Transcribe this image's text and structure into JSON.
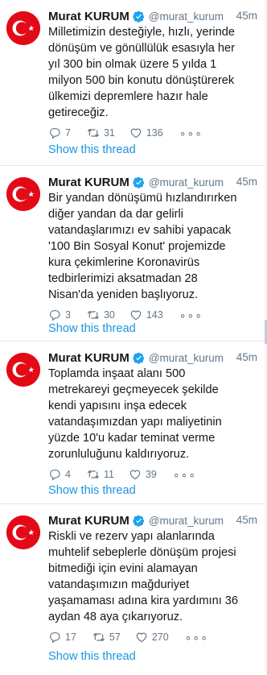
{
  "tweets": [
    {
      "name": "Murat KURUM",
      "handle": "@murat_kurum",
      "time": "45m",
      "text": "Milletimizin desteğiyle, hızlı, yerinde\ndönüşüm ve gönüllülük esasıyla her\nyıl 300 bin olmak üzere 5 yılda 1\nmilyon 500 bin konutu dönüştürerek\nülkemizi depremlere hazır hale\ngetireceğiz.",
      "replies": "7",
      "retweets": "31",
      "likes": "136",
      "thread_label": "Show this thread"
    },
    {
      "name": "Murat KURUM",
      "handle": "@murat_kurum",
      "time": "45m",
      "text": "Bir yandan dönüşümü hızlandırırken\ndiğer yandan da dar gelirli\nvatandaşlarımızı ev sahibi yapacak\n'100 Bin Sosyal Konut' projemizde\nkura çekimlerine Koronavirüs\ntedbirlerimizi aksatmadan 28\nNisan'da yeniden başlıyoruz.",
      "replies": "3",
      "retweets": "30",
      "likes": "143",
      "thread_label": "Show this thread"
    },
    {
      "name": "Murat KURUM",
      "handle": "@murat_kurum",
      "time": "45m",
      "text": "Toplamda inşaat alanı 500\nmetrekareyi geçmeyecek şekilde\nkendi yapısını inşa edecek\nvatandaşımızdan yapı maliyetinin\nyüzde 10'u kadar teminat verme\nzorunluluğunu kaldırıyoruz.",
      "replies": "4",
      "retweets": "11",
      "likes": "39",
      "thread_label": "Show this thread"
    },
    {
      "name": "Murat KURUM",
      "handle": "@murat_kurum",
      "time": "45m",
      "text": "Riskli ve rezerv yapı alanlarında\nmuhtelif sebeplerle dönüşüm projesi\nbitmediği için evini alamayan\nvatandaşımızın mağduriyet\nyaşamaması adına kira yardımını 36\naydan 48 aya çıkarıyoruz.",
      "replies": "17",
      "retweets": "57",
      "likes": "270",
      "thread_label": "Show this thread"
    }
  ],
  "more_glyph": "∘∘∘",
  "colors": {
    "link": "#1b95e0",
    "muted": "#657786",
    "text": "#14171a",
    "avatar_red": "#e30a17",
    "verified": "#1da1f2"
  },
  "icons": {
    "avatar": "turkish-flag-avatar",
    "verified": "verified-badge-icon",
    "reply": "reply-icon",
    "retweet": "retweet-icon",
    "like": "heart-icon",
    "more": "more-icon"
  }
}
